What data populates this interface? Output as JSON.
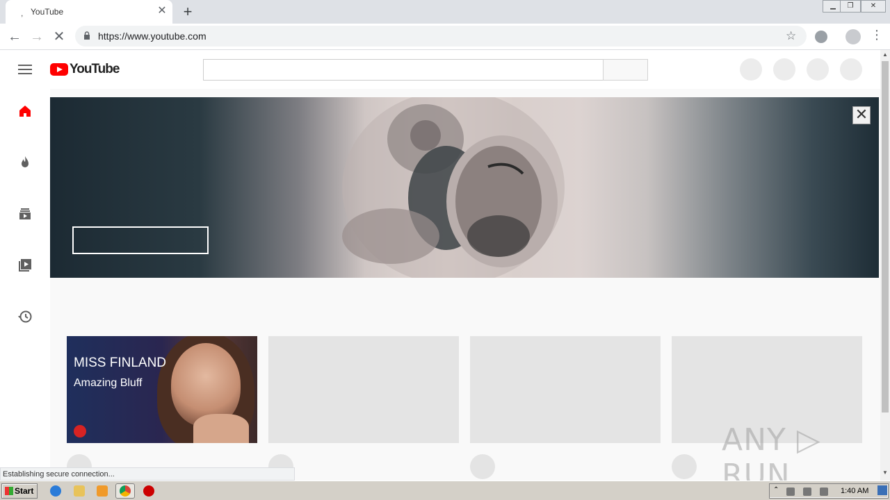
{
  "browser": {
    "tab_title": "YouTube",
    "tab_icon_glyph": "̦",
    "url": "https://www.youtube.com",
    "status_text": "Establishing secure connection..."
  },
  "youtube": {
    "logo_text": "YouTube",
    "search_placeholder": "",
    "sidebar_items": [
      "home-icon",
      "trending-icon",
      "subscriptions-icon",
      "library-icon",
      "history-icon"
    ],
    "accent_color": "#ff0000"
  },
  "banner": {
    "close_glyph": "✕"
  },
  "videos": [
    {
      "thumbnail_title": "MISS FINLAND",
      "thumbnail_subtitle": "Amazing Bluff"
    },
    {
      "thumbnail_title": "",
      "thumbnail_subtitle": ""
    },
    {
      "thumbnail_title": "",
      "thumbnail_subtitle": ""
    },
    {
      "thumbnail_title": "",
      "thumbnail_subtitle": ""
    }
  ],
  "watermark": "ANY ▷ RUN",
  "taskbar": {
    "start_label": "Start",
    "clock": "1:40 AM"
  }
}
